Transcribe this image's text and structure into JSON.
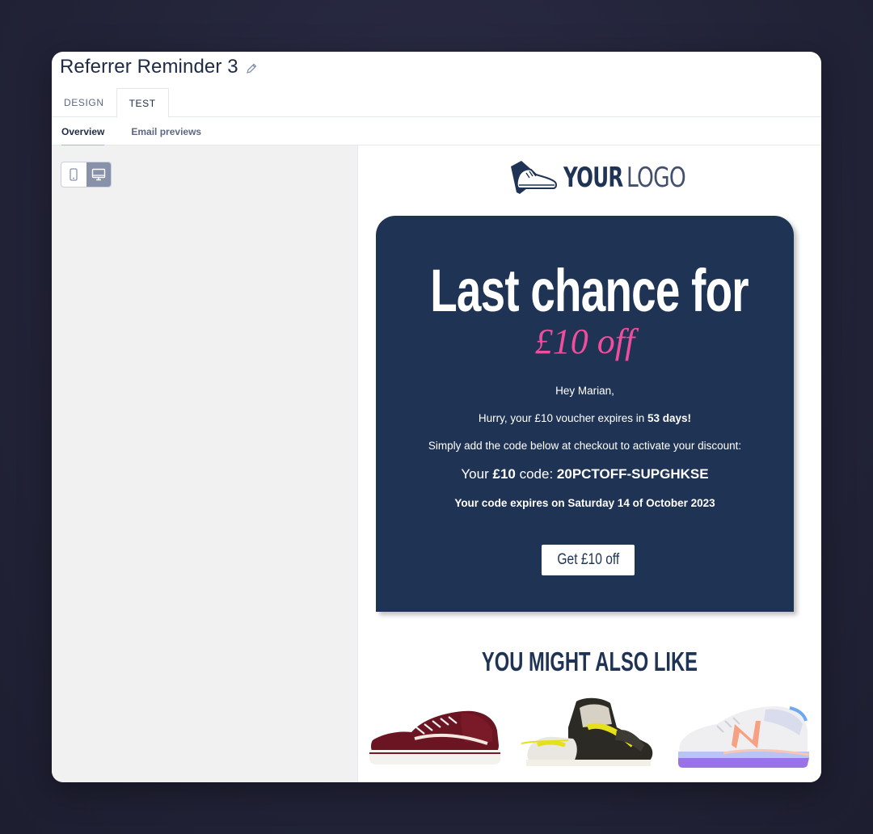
{
  "header": {
    "title": "Referrer Reminder 3",
    "edit_icon": "pencil-icon"
  },
  "tabs": [
    {
      "label": "DESIGN",
      "active": false
    },
    {
      "label": "TEST",
      "active": true
    }
  ],
  "subtabs": [
    {
      "label": "Overview",
      "active": true
    },
    {
      "label": "Email previews",
      "active": false
    }
  ],
  "device_toggle": {
    "options": [
      "mobile-icon",
      "desktop-icon"
    ],
    "selected": "desktop"
  },
  "email": {
    "logo": {
      "bold": "YOUR",
      "light": "LOGO",
      "icon": "sneaker-icon"
    },
    "hero": {
      "headline": "Last chance for",
      "subheadline": "£10 off",
      "greeting": "Hey Marian,",
      "expiry_prefix": "Hurry, your £10 voucher expires in ",
      "expiry_days": "53 days!",
      "instructions": "Simply add the code below at checkout to activate your discount:",
      "code_prefix": "Your ",
      "code_amount": "£10",
      "code_label": " code: ",
      "code": "20PCTOFF-SUPGHKSE",
      "code_expiry": "Your code expires on Saturday 14 of October 2023",
      "cta_label": "Get £10 off"
    },
    "recommendations": {
      "title": "YOU MIGHT ALSO LIKE",
      "products": [
        "burgundy-sneaker-image",
        "yellow-high-top-sneaker-image",
        "white-running-shoe-image"
      ]
    }
  },
  "colors": {
    "navy": "#1f3354",
    "pink": "#f04e9c",
    "accent_underline": "#f2b90b",
    "toggle_active": "#8791aa"
  }
}
